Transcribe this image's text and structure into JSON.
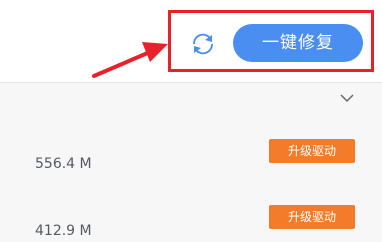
{
  "header": {
    "repair_button_label": "一键修复",
    "refresh_icon": "refresh-icon"
  },
  "annotation": {
    "highlight_color": "#e8212a",
    "arrow_icon": "red-arrow-icon"
  },
  "driver_list": {
    "expand_icon": "chevron-down-icon",
    "items": [
      {
        "size": "556.4 M",
        "action_label": "升级驱动"
      },
      {
        "size": "412.9 M",
        "action_label": "升级驱动"
      }
    ]
  },
  "colors": {
    "primary_blue": "#4a8ef2",
    "update_orange": "#f47b2a",
    "annotation_red": "#e8212a"
  }
}
